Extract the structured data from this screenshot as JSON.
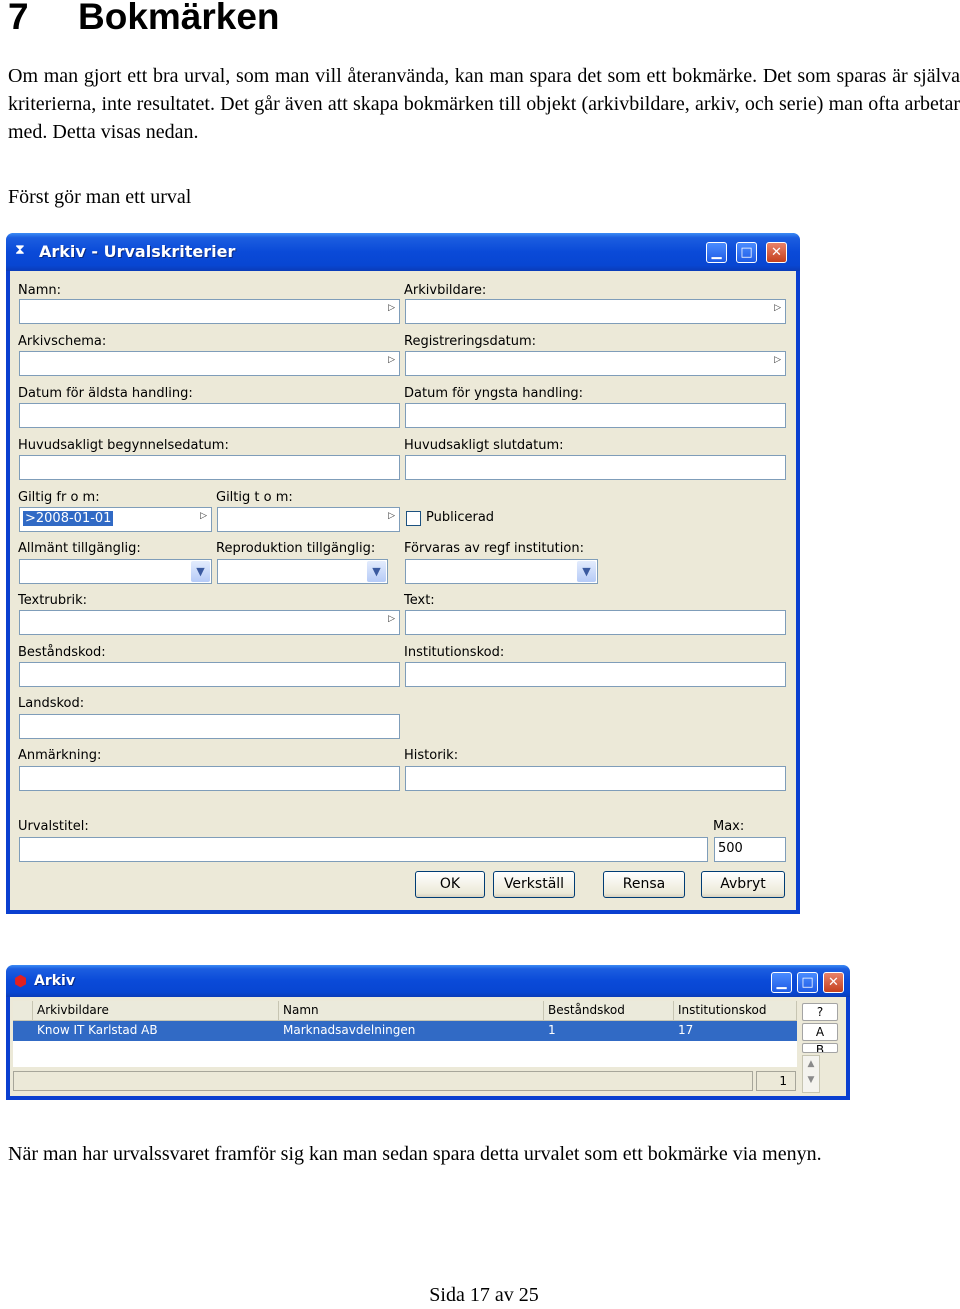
{
  "heading": {
    "number": "7",
    "title": "Bokmärken"
  },
  "intro": "Om man gjort ett bra urval, som man vill återanvända, kan man spara det som ett bokmärke. Det som sparas är själva kriterierna, inte resultatet. Det går även att skapa bokmärken till objekt (arkivbildare, arkiv, och serie) man ofta arbetar med. Detta visas nedan.",
  "step1": "Först gör man ett urval",
  "criteria_window": {
    "title": "Arkiv - Urvalskriterier",
    "labels": {
      "namn": "Namn:",
      "arkivbildare": "Arkivbildare:",
      "arkivschema": "Arkivschema:",
      "registreringsdatum": "Registreringsdatum:",
      "aldsta": "Datum för äldsta handling:",
      "yngsta": "Datum för yngsta handling:",
      "begynnelse": "Huvudsakligt begynnelsedatum:",
      "slut": "Huvudsakligt slutdatum:",
      "giltig_from": "Giltig fr o m:",
      "giltig_tom": "Giltig t o m:",
      "publicerad": "Publicerad",
      "allmant": "Allmänt tillgänglig:",
      "reproduktion": "Reproduktion tillgänglig:",
      "forvaras": "Förvaras av regf institution:",
      "textrubrik": "Textrubrik:",
      "text": "Text:",
      "bestandskod": "Beståndskod:",
      "institutionskod": "Institutionskod:",
      "landskod": "Landskod:",
      "anmarkning": "Anmärkning:",
      "historik": "Historik:",
      "urvalstitel": "Urvalstitel:",
      "max": "Max:"
    },
    "values": {
      "giltig_from": ">2008-01-01",
      "max": "500"
    },
    "buttons": {
      "ok": "OK",
      "verkstall": "Verkställ",
      "rensa": "Rensa",
      "avbryt": "Avbryt"
    }
  },
  "result_window": {
    "title": "Arkiv",
    "columns": [
      "Arkivbildare",
      "Namn",
      "Beståndskod",
      "Institutionskod"
    ],
    "row": [
      "Know IT Karlstad AB",
      "Marknadsavdelningen",
      "1",
      "17"
    ],
    "side_buttons": [
      "?",
      "A",
      "B"
    ],
    "count": "1"
  },
  "step2": "När man har urvalssvaret framför sig kan man sedan spara detta urvalet som ett bokmärke via menyn.",
  "footer": "Sida 17 av 25"
}
